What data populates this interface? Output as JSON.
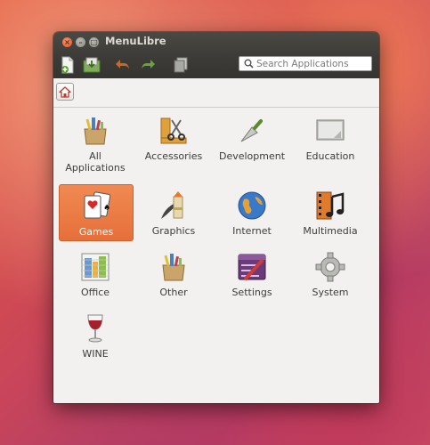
{
  "window": {
    "title": "MenuLibre"
  },
  "toolbar": {
    "search_placeholder": "Search Applications",
    "tools": [
      "add-launcher-icon",
      "save-icon",
      "undo-icon",
      "redo-icon",
      "revert-icon"
    ]
  },
  "breadcrumb": {
    "home_icon": "home-icon"
  },
  "categories": [
    {
      "label": "All\nApplications",
      "icon": "all-applications-icon",
      "selected": false
    },
    {
      "label": "Accessories",
      "icon": "accessories-icon",
      "selected": false
    },
    {
      "label": "Development",
      "icon": "development-icon",
      "selected": false
    },
    {
      "label": "Education",
      "icon": "education-icon",
      "selected": false
    },
    {
      "label": "Games",
      "icon": "games-icon",
      "selected": true
    },
    {
      "label": "Graphics",
      "icon": "graphics-icon",
      "selected": false
    },
    {
      "label": "Internet",
      "icon": "internet-icon",
      "selected": false
    },
    {
      "label": "Multimedia",
      "icon": "multimedia-icon",
      "selected": false
    },
    {
      "label": "Office",
      "icon": "office-icon",
      "selected": false
    },
    {
      "label": "Other",
      "icon": "other-icon",
      "selected": false
    },
    {
      "label": "Settings",
      "icon": "settings-icon",
      "selected": false
    },
    {
      "label": "System",
      "icon": "system-icon",
      "selected": false
    },
    {
      "label": "WINE",
      "icon": "wine-icon",
      "selected": false
    }
  ],
  "colors": {
    "selection": "#e66f3a",
    "titlebar": "#3c3b37",
    "background": "#f2f1f0"
  }
}
